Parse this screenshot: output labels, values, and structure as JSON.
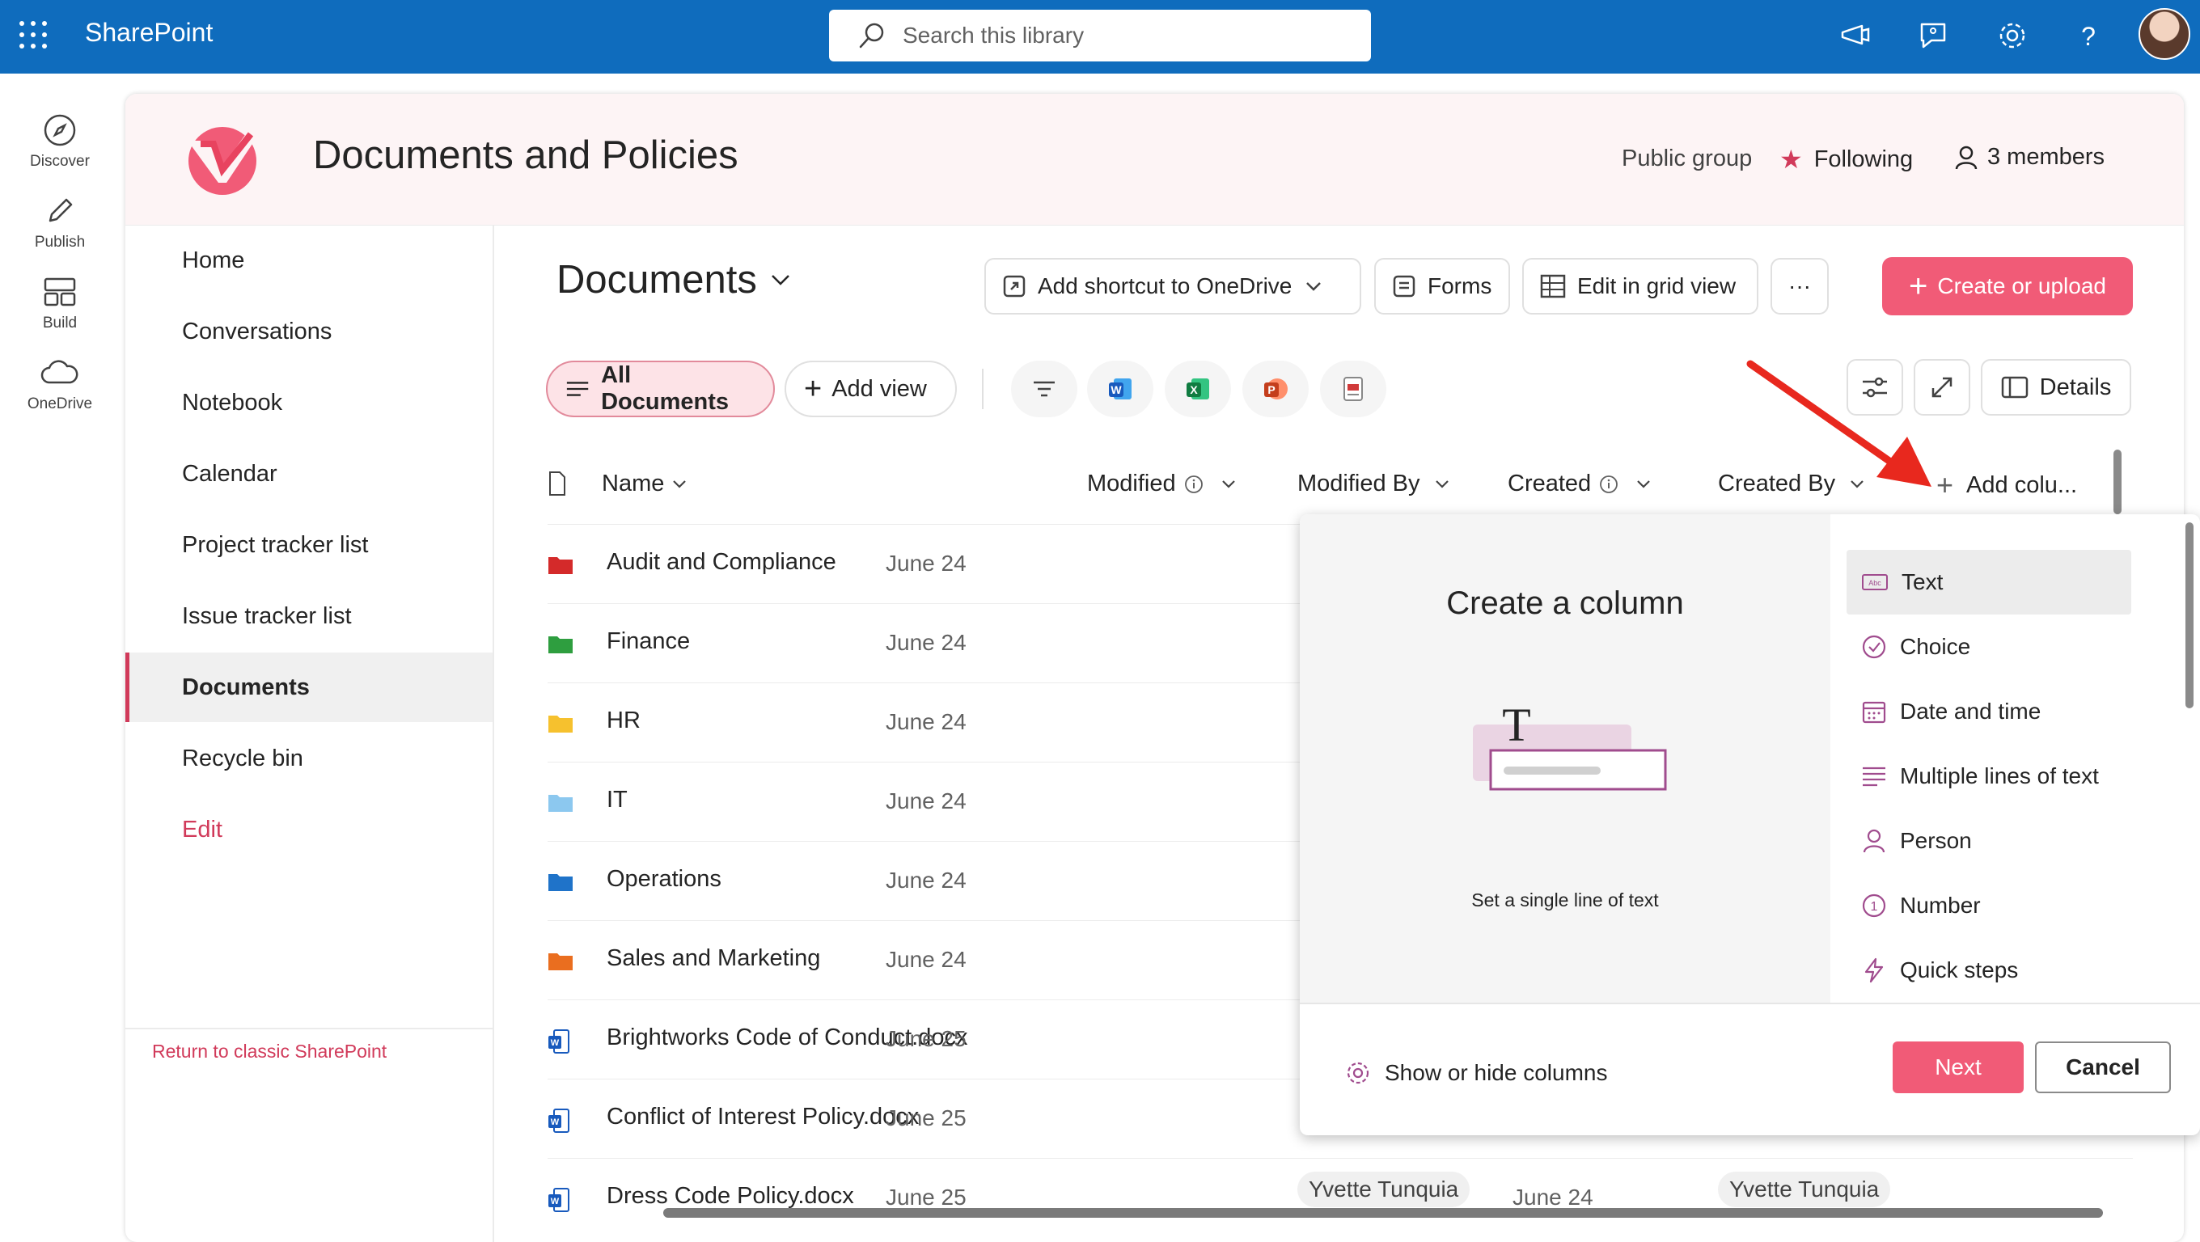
{
  "app": {
    "title": "SharePoint"
  },
  "search": {
    "placeholder": "Search this library"
  },
  "rail": [
    {
      "label": "Discover",
      "icon": "compass-icon"
    },
    {
      "label": "Publish",
      "icon": "pen-icon"
    },
    {
      "label": "Build",
      "icon": "layout-icon"
    },
    {
      "label": "OneDrive",
      "icon": "cloud-icon"
    }
  ],
  "site": {
    "title": "Documents and Policies",
    "public_group": "Public group",
    "following": "Following",
    "members": "3 members"
  },
  "nav": {
    "items": [
      "Home",
      "Conversations",
      "Notebook",
      "Calendar",
      "Project tracker list",
      "Issue tracker list",
      "Documents",
      "Recycle bin",
      "Edit"
    ],
    "active": "Documents",
    "classic_link": "Return to classic SharePoint"
  },
  "library": {
    "title": "Documents",
    "add_shortcut": "Add shortcut to OneDrive",
    "forms": "Forms",
    "edit_grid": "Edit in grid view",
    "more": "···",
    "create_upload": "Create or upload",
    "view_selected": "All Documents",
    "add_view": "Add view",
    "details": "Details"
  },
  "columns": {
    "name": "Name",
    "modified": "Modified",
    "modified_by": "Modified By",
    "created": "Created",
    "created_by": "Created By",
    "add_column": "Add colu..."
  },
  "rows": [
    {
      "name": "Audit and Compliance",
      "modified": "June 24",
      "type": "folder",
      "color": "#d42a2a"
    },
    {
      "name": "Finance",
      "modified": "June 24",
      "type": "folder",
      "color": "#2e9e3f"
    },
    {
      "name": "HR",
      "modified": "June 24",
      "type": "folder",
      "color": "#f6c12e"
    },
    {
      "name": "IT",
      "modified": "June 24",
      "type": "folder",
      "color": "#8cc8ef"
    },
    {
      "name": "Operations",
      "modified": "June 24",
      "type": "folder",
      "color": "#1f73c9"
    },
    {
      "name": "Sales and Marketing",
      "modified": "June 24",
      "type": "folder",
      "color": "#ea6e1f"
    },
    {
      "name": "Brightworks Code of Conduct.docx",
      "modified": "June 25",
      "type": "docx"
    },
    {
      "name": "Conflict of Interest Policy.docx",
      "modified": "June 25",
      "type": "docx"
    },
    {
      "name": "Dress Code Policy.docx",
      "modified": "June 25",
      "type": "docx",
      "modified_by": "Yvette Tunquia",
      "created": "June 24",
      "created_by": "Yvette Tunquia"
    }
  ],
  "create_column": {
    "title": "Create a column",
    "description": "Set a single line of text",
    "types": [
      {
        "label": "Text",
        "icon": "text-icon"
      },
      {
        "label": "Choice",
        "icon": "choice-icon"
      },
      {
        "label": "Date and time",
        "icon": "calendar-icon"
      },
      {
        "label": "Multiple lines of text",
        "icon": "lines-icon"
      },
      {
        "label": "Person",
        "icon": "person-icon"
      },
      {
        "label": "Number",
        "icon": "number-icon"
      },
      {
        "label": "Quick steps",
        "icon": "lightning-icon"
      }
    ],
    "selected": "Text",
    "show_hide": "Show or hide columns",
    "next": "Next",
    "cancel": "Cancel"
  },
  "colors": {
    "brand_blue": "#0f6cbd",
    "accent_pink": "#f15b77",
    "annotation_red": "#e8281e"
  }
}
